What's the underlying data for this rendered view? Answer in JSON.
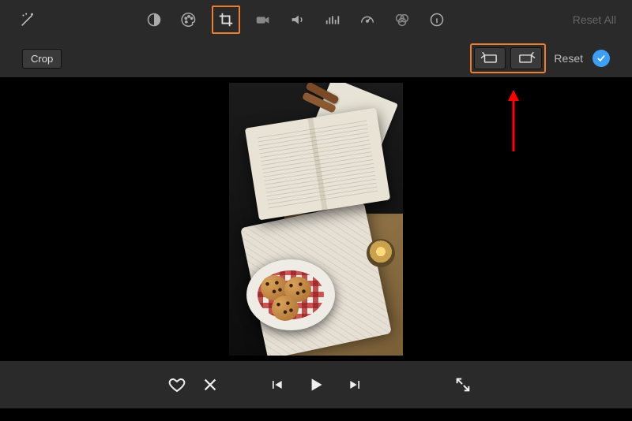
{
  "toolbar": {
    "reset_all": "Reset All"
  },
  "subbar": {
    "crop_label": "Crop",
    "reset_label": "Reset"
  },
  "icons": {
    "wand": "magic-wand-icon",
    "contrast": "color-balance-icon",
    "palette": "color-palette-icon",
    "crop": "crop-icon",
    "camera": "video-camera-icon",
    "volume": "volume-icon",
    "equalizer": "equalizer-icon",
    "speed": "speedometer-icon",
    "filters": "filters-overlap-icon",
    "info": "info-icon",
    "rotate_ccw": "rotate-ccw-icon",
    "rotate_cw": "rotate-cw-icon",
    "check": "checkmark-icon",
    "heart": "favorite-icon",
    "reject": "reject-icon",
    "prev": "skip-previous-icon",
    "play": "play-icon",
    "next": "skip-next-icon",
    "fullscreen": "fullscreen-icon"
  },
  "colors": {
    "highlight": "#ed7d31",
    "accent": "#3a9ff5",
    "arrow": "#ff0000"
  }
}
